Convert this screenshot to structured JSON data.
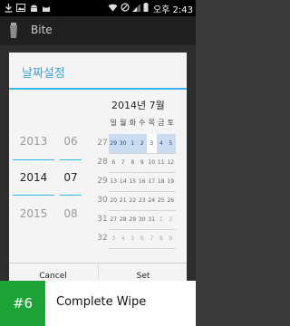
{
  "status_bar": {
    "time_label": "오후 2:43",
    "icons": [
      "download-icon",
      "image-icon",
      "android-icon",
      "cat-icon",
      "wifi-icon",
      "no-sim-icon",
      "signal-icon",
      "battery-icon"
    ]
  },
  "action_bar": {
    "title": "Bite",
    "icon": "app-icon"
  },
  "dialog": {
    "title": "날짜설정",
    "year_picker": {
      "prev": "2013",
      "selected": "2014",
      "next": "2015"
    },
    "month_picker": {
      "prev": "06",
      "selected": "07",
      "next": "08"
    },
    "calendar": {
      "title": "2014년 7월",
      "weekdays": [
        "일",
        "월",
        "화",
        "수",
        "목",
        "금",
        "토"
      ],
      "weeks": [
        {
          "num": "27",
          "days": [
            "29",
            "30",
            "1",
            "2",
            "3",
            "4",
            "5"
          ]
        },
        {
          "num": "28",
          "days": [
            "6",
            "7",
            "8",
            "9",
            "10",
            "11",
            "12"
          ]
        },
        {
          "num": "29",
          "days": [
            "13",
            "14",
            "15",
            "16",
            "17",
            "18",
            "19"
          ]
        },
        {
          "num": "30",
          "days": [
            "20",
            "21",
            "22",
            "23",
            "24",
            "25",
            "26"
          ]
        },
        {
          "num": "31",
          "days": [
            "27",
            "28",
            "29",
            "30",
            "31",
            "1",
            "2"
          ]
        },
        {
          "num": "32",
          "days": [
            "3",
            "4",
            "5",
            "6",
            "7",
            "8",
            "9"
          ]
        }
      ],
      "selected_day": "3",
      "accent_color": "#33b5e5",
      "highlight_color": "#c9dcf2"
    },
    "cancel_label": "Cancel",
    "set_label": "Set"
  },
  "banner": {
    "rank": "#6",
    "title": "Complete Wipe",
    "badge_color": "#1ea336"
  }
}
